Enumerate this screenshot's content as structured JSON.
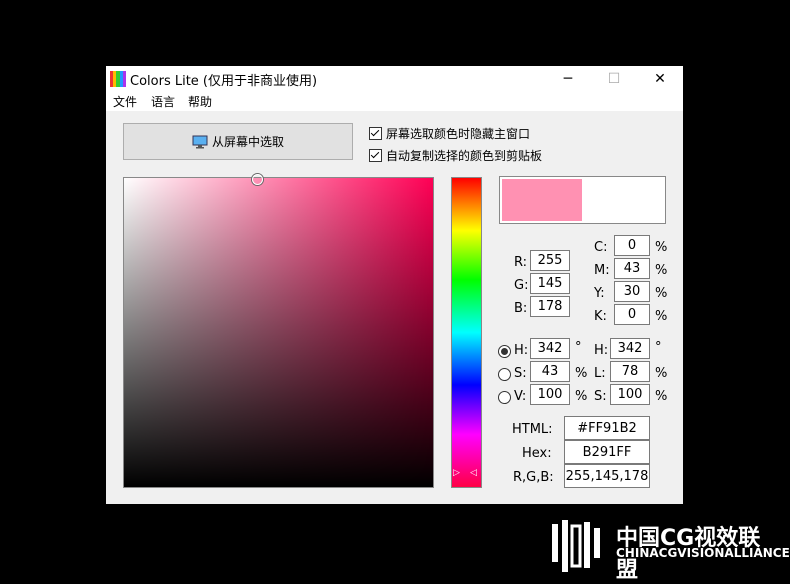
{
  "window": {
    "title": "Colors Lite (仅用于非商业使用)",
    "minimize_glyph": "─",
    "maximize_glyph": "☐",
    "close_glyph": "✕"
  },
  "menu": [
    "文件",
    "语言",
    "帮助"
  ],
  "pick_button": {
    "label": "从屏幕中选取",
    "icon": "monitor-icon"
  },
  "options": [
    {
      "label": "屏幕选取颜色时隐藏主窗口",
      "checked": true
    },
    {
      "label": "自动复制选择的颜色到剪贴板",
      "checked": true
    }
  ],
  "current_color": "#FF91B2",
  "rgb": {
    "r_label": "R:",
    "r": "255",
    "g_label": "G:",
    "g": "145",
    "b_label": "B:",
    "b": "178"
  },
  "cmyk": {
    "c_label": "C:",
    "c": "0",
    "m_label": "M:",
    "m": "43",
    "y_label": "Y:",
    "y": "30",
    "k_label": "K:",
    "k": "0",
    "unit": "%"
  },
  "hsv": {
    "h_label": "H:",
    "h": "342",
    "s_label": "S:",
    "s": "43",
    "v_label": "V:",
    "v": "100",
    "selected": "H"
  },
  "hsl": {
    "h_label": "H:",
    "h": "342",
    "l_label": "L:",
    "l": "78",
    "s_label": "S:",
    "s": "100"
  },
  "units": {
    "degree": "°",
    "percent": "%"
  },
  "codes": {
    "html_label": "HTML:",
    "html": "#FF91B2",
    "hex_label": "Hex:",
    "hex": "B291FF",
    "rgb_label": "R,G,B:",
    "rgb": "255,145,178"
  },
  "watermark": {
    "line1": "中国CG视效联盟",
    "line2": "CHINACGVISIONALLIANCE"
  }
}
